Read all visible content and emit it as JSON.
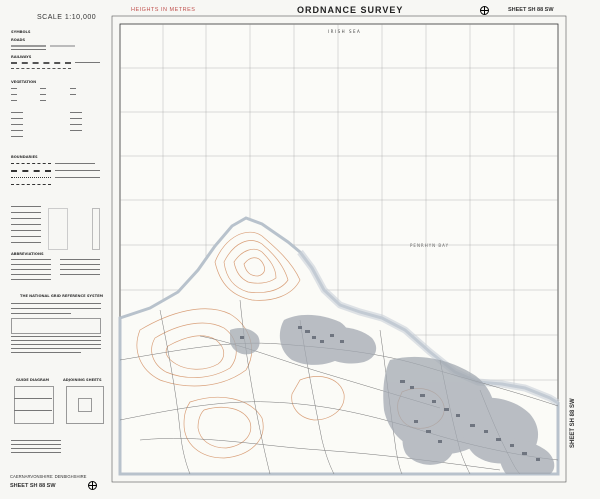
{
  "header": {
    "scale": "SCALE 1:10,000",
    "heights": "HEIGHTS IN METRES",
    "title": "ORDNANCE SURVEY",
    "sheet": "SHEET SH 88 SW"
  },
  "map": {
    "sea_label": "IRISH SEA",
    "bay_label": "PENRHYN BAY"
  },
  "legend": {
    "symbols": "SYMBOLS",
    "roads": "ROADS",
    "railways": "RAILWAYS",
    "vegetation": "VEGETATION",
    "boundaries": "BOUNDARIES",
    "abbreviations": "ABBREVIATIONS",
    "grid_title": "THE NATIONAL GRID REFERENCE SYSTEM",
    "guide_diagram": "GUIDE DIAGRAM",
    "adjoining_sheets": "ADJOINING SHEETS"
  },
  "footer": {
    "county": "CAERNARVONSHIRE: DENBIGHSHIRE",
    "sheet": "SHEET SH 88 SW"
  },
  "colors": {
    "contour": "#d9a07a",
    "built_up": "#8a8f99",
    "coast": "#b8c2cc",
    "grid": "#7a7a7a"
  }
}
